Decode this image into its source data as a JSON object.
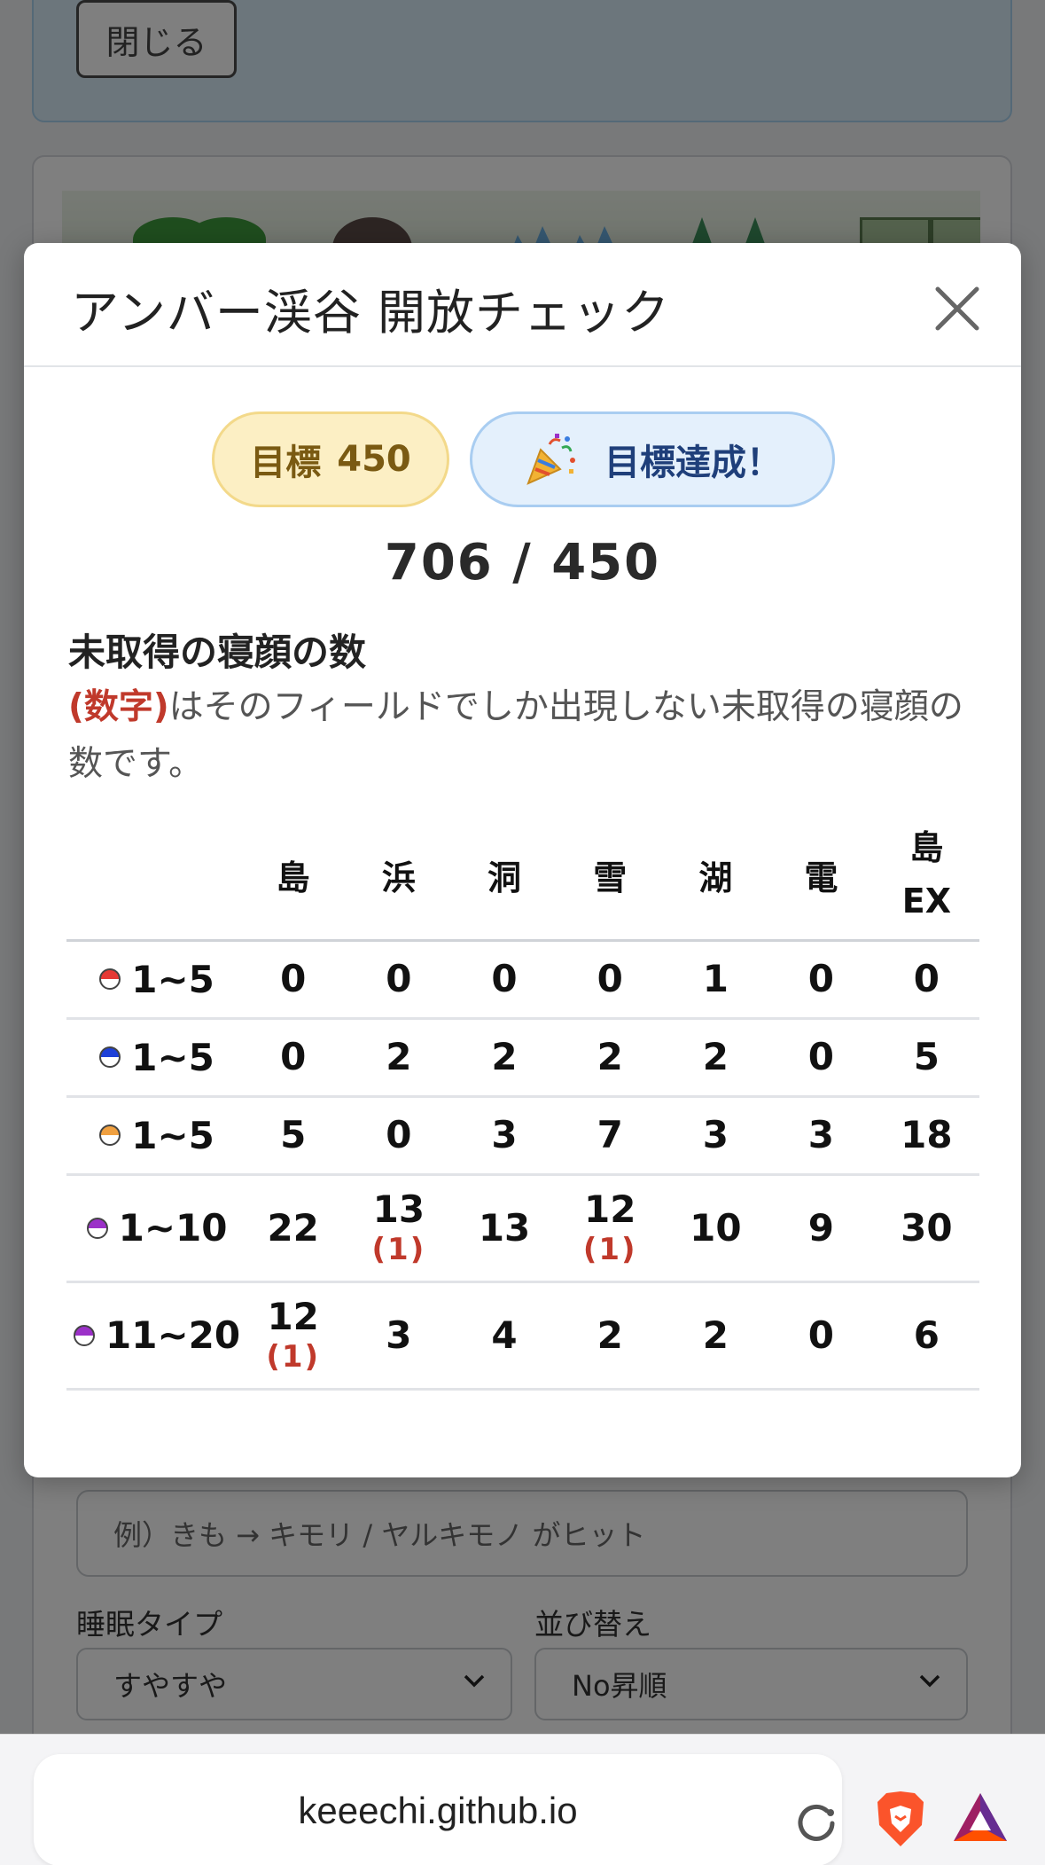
{
  "background": {
    "close_button": "閉じる",
    "search_placeholder": "例）きも → キモリ / ヤルキモノ がヒット",
    "sleep_type_label": "睡眠タイプ",
    "sleep_type_value": "すやすや",
    "sort_label": "並び替え",
    "sort_value": "No昇順"
  },
  "modal": {
    "title": "アンバー渓谷 開放チェック",
    "goal_label": "目標",
    "goal_value": "450",
    "achieved_label": "目標達成！",
    "score": "706 / 450",
    "section_title": "未取得の寝顔の数",
    "desc_highlight": "(数字)",
    "desc_text": "はそのフィールドでしか出現しない未取得の寝顔の数です。",
    "columns": [
      "島",
      "浜",
      "洞",
      "雪",
      "湖",
      "電",
      "島\nEX"
    ],
    "rows": [
      {
        "color": "#e53935",
        "label": "1~5",
        "cells": [
          {
            "v": "0"
          },
          {
            "v": "0"
          },
          {
            "v": "0"
          },
          {
            "v": "0"
          },
          {
            "v": "1"
          },
          {
            "v": "0"
          },
          {
            "v": "0"
          }
        ]
      },
      {
        "color": "#1e40d8",
        "label": "1~5",
        "cells": [
          {
            "v": "0"
          },
          {
            "v": "2"
          },
          {
            "v": "2"
          },
          {
            "v": "2"
          },
          {
            "v": "2"
          },
          {
            "v": "0"
          },
          {
            "v": "5"
          }
        ]
      },
      {
        "color": "#f0a040",
        "label": "1~5",
        "cells": [
          {
            "v": "5"
          },
          {
            "v": "0"
          },
          {
            "v": "3"
          },
          {
            "v": "7"
          },
          {
            "v": "3"
          },
          {
            "v": "3"
          },
          {
            "v": "18"
          }
        ]
      },
      {
        "color": "#9b30c8",
        "label": "1~10",
        "cells": [
          {
            "v": "22"
          },
          {
            "v": "13",
            "s": "(1)"
          },
          {
            "v": "13"
          },
          {
            "v": "12",
            "s": "(1)"
          },
          {
            "v": "10"
          },
          {
            "v": "9"
          },
          {
            "v": "30"
          }
        ]
      },
      {
        "color": "#9b30c8",
        "label": "11~20",
        "cells": [
          {
            "v": "12",
            "s": "(1)"
          },
          {
            "v": "3"
          },
          {
            "v": "4"
          },
          {
            "v": "2"
          },
          {
            "v": "2"
          },
          {
            "v": "0"
          },
          {
            "v": "6"
          }
        ]
      }
    ]
  },
  "browser": {
    "url": "keeechi.github.io"
  }
}
